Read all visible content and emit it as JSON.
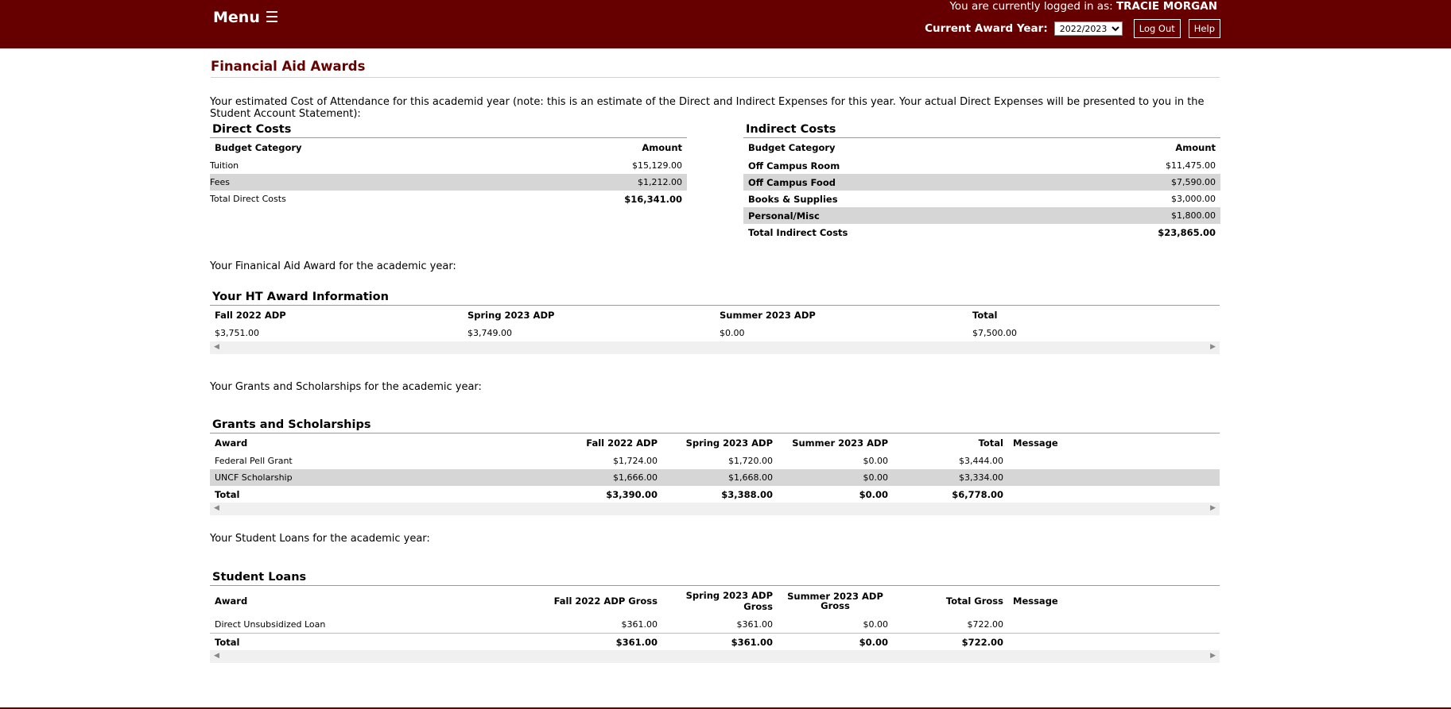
{
  "header": {
    "menu_label": "Menu ☰",
    "logged_in_prefix": "You are currently logged in as: ",
    "user_name": "TRACIE MORGAN",
    "award_year_label": "Current Award Year:",
    "award_year_selected": "2022/2023",
    "logout_label": "Log Out",
    "help_label": "Help"
  },
  "page": {
    "title": "Financial Aid Awards",
    "intro": "Your estimated Cost of Attendance for this academid year (note: this is an estimate of the Direct and Indirect Expenses for this year. Your actual Direct Expenses will be presented to you in the Student Account Statement):"
  },
  "direct_costs": {
    "title": "Direct Costs",
    "col_category": "Budget Category",
    "col_amount": "Amount",
    "rows": [
      {
        "category": "Tuition",
        "amount": "$15,129.00"
      },
      {
        "category": "Fees",
        "amount": "$1,212.00"
      }
    ],
    "total_label": "Total Direct Costs",
    "total_amount": "$16,341.00"
  },
  "indirect_costs": {
    "title": "Indirect Costs",
    "col_category": "Budget Category",
    "col_amount": "Amount",
    "rows": [
      {
        "category": "Off Campus Room",
        "amount": "$11,475.00"
      },
      {
        "category": "Off Campus Food",
        "amount": "$7,590.00"
      },
      {
        "category": "Books & Supplies",
        "amount": "$3,000.00"
      },
      {
        "category": "Personal/Misc",
        "amount": "$1,800.00"
      }
    ],
    "total_label": "Total Indirect Costs",
    "total_amount": "$23,865.00"
  },
  "ht_award": {
    "lead": "Your Finanical Aid Award for the academic year:",
    "title": "Your HT Award Information",
    "cols": [
      "Fall 2022 ADP",
      "Spring 2023 ADP",
      "Summer 2023 ADP",
      "Total"
    ],
    "values": [
      "$3,751.00",
      "$3,749.00",
      "$0.00",
      "$7,500.00"
    ]
  },
  "grants": {
    "lead": "Your Grants and Scholarships for the academic year:",
    "title": "Grants and Scholarships",
    "cols": [
      "Award",
      "Fall 2022 ADP",
      "Spring 2023 ADP",
      "Summer 2023 ADP",
      "Total",
      "Message"
    ],
    "rows": [
      {
        "award": "Federal Pell Grant",
        "fall": "$1,724.00",
        "spring": "$1,720.00",
        "summer": "$0.00",
        "total": "$3,444.00",
        "message": ""
      },
      {
        "award": "UNCF Scholarship",
        "fall": "$1,666.00",
        "spring": "$1,668.00",
        "summer": "$0.00",
        "total": "$3,334.00",
        "message": ""
      }
    ],
    "total_row": {
      "award": "Total",
      "fall": "$3,390.00",
      "spring": "$3,388.00",
      "summer": "$0.00",
      "total": "$6,778.00"
    }
  },
  "loans": {
    "lead": "Your Student Loans for the academic year:",
    "title": "Student Loans",
    "cols": [
      "Award",
      "Fall 2022 ADP Gross",
      "Spring 2023 ADP Gross",
      "Summer 2023 ADP Gross",
      "Total Gross",
      "Message"
    ],
    "rows": [
      {
        "award": "Direct Unsubsidized Loan",
        "fall": "$361.00",
        "spring": "$361.00",
        "summer": "$0.00",
        "total": "$722.00",
        "message": ""
      }
    ],
    "total_row": {
      "award": "Total",
      "fall": "$361.00",
      "spring": "$361.00",
      "summer": "$0.00",
      "total": "$722.00"
    }
  },
  "colors": {
    "brand": "#660000",
    "row_shade": "#d6d6d6",
    "title_rule": "#e6d48a"
  },
  "icons": {
    "menu": "hamburger-icon",
    "scroll_left": "arrow-left-icon",
    "scroll_right": "arrow-right-icon",
    "dropdown": "chevron-down-icon"
  }
}
